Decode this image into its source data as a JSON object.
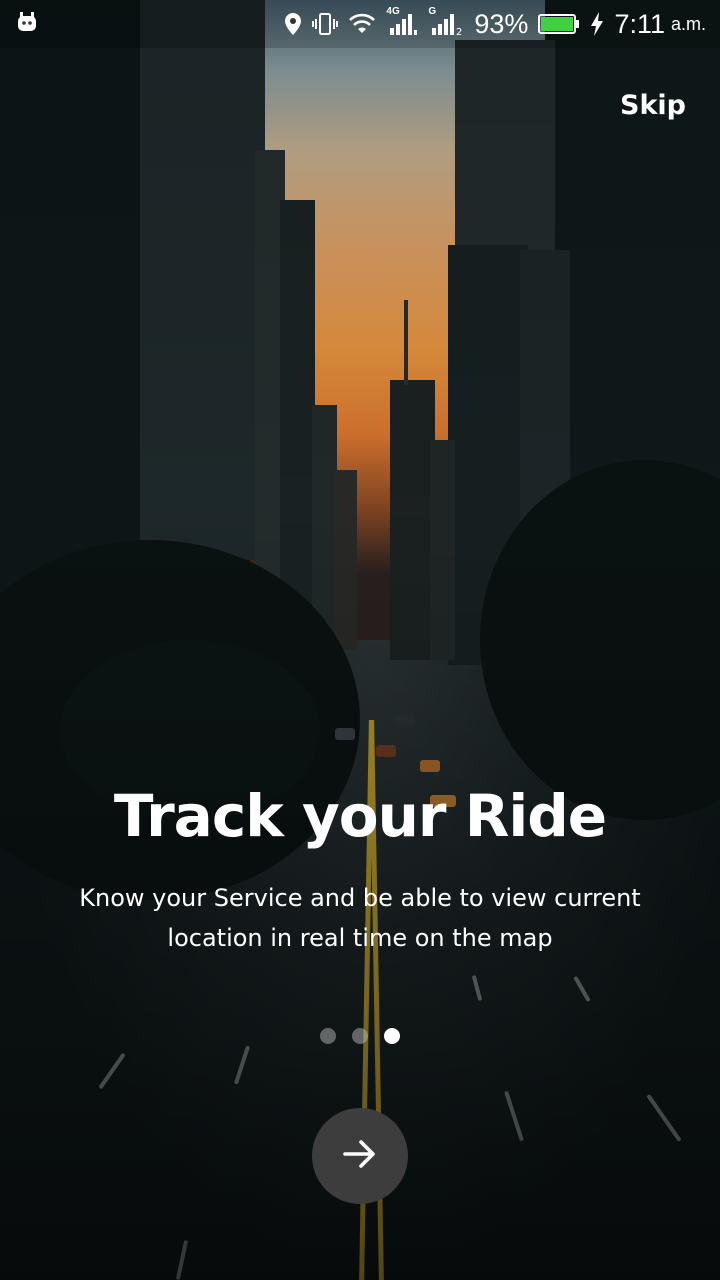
{
  "status_bar": {
    "battery": "93%",
    "time": "7:11",
    "ampm": "a.m.",
    "network_primary": "4G",
    "network_secondary": "G",
    "icons": [
      "notification-app-icon",
      "location-icon",
      "vibrate-icon",
      "wifi-icon",
      "signal-4g-icon",
      "signal-g-icon",
      "battery-icon",
      "charging-icon"
    ],
    "battery_color": "#3fd13f"
  },
  "header": {
    "skip_label": "Skip"
  },
  "onboarding": {
    "title": "Track your Ride",
    "description": "Know your Service and be able to view current location in real time on the map",
    "page_count": 3,
    "active_page": 3
  },
  "next_button": {
    "icon": "arrow-right-icon",
    "color": "#3d3d3d"
  }
}
